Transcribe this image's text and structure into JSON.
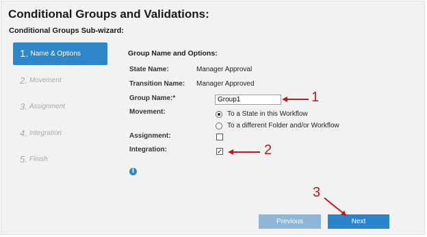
{
  "page_title": "Conditional Groups and Validations:",
  "subwizard_title": "Conditional Groups Sub-wizard:",
  "steps": [
    {
      "num": "1.",
      "label": "Name & Options",
      "active": true
    },
    {
      "num": "2.",
      "label": "Movement",
      "active": false
    },
    {
      "num": "3.",
      "label": "Assignment",
      "active": false
    },
    {
      "num": "4.",
      "label": "Integration",
      "active": false
    },
    {
      "num": "5.",
      "label": "Finish",
      "active": false
    }
  ],
  "form": {
    "section_title": "Group Name and Options:",
    "state_name_label": "State Name:",
    "state_name_value": "Manager Approval",
    "transition_name_label": "Transition Name:",
    "transition_name_value": "Manager Approved",
    "group_name_label": "Group Name:*",
    "group_name_value": "Group1",
    "movement_label": "Movement:",
    "movement_options": [
      {
        "label": "To a State in this Workflow",
        "selected": true
      },
      {
        "label": "To a different Folder and/or Workflow",
        "selected": false
      }
    ],
    "assignment_label": "Assignment:",
    "assignment_checked": false,
    "integration_label": "Integration:",
    "integration_checked": true,
    "checkmark": "✓",
    "info_glyph": "i"
  },
  "buttons": {
    "previous": "Previous",
    "next": "Next"
  },
  "callouts": [
    "1",
    "2",
    "3"
  ],
  "colors": {
    "accent": "#2f86c9",
    "annotation": "#c0161c",
    "disabled_button": "#8fb6d8"
  },
  "icons": [
    "info-icon",
    "annotation-arrow"
  ]
}
